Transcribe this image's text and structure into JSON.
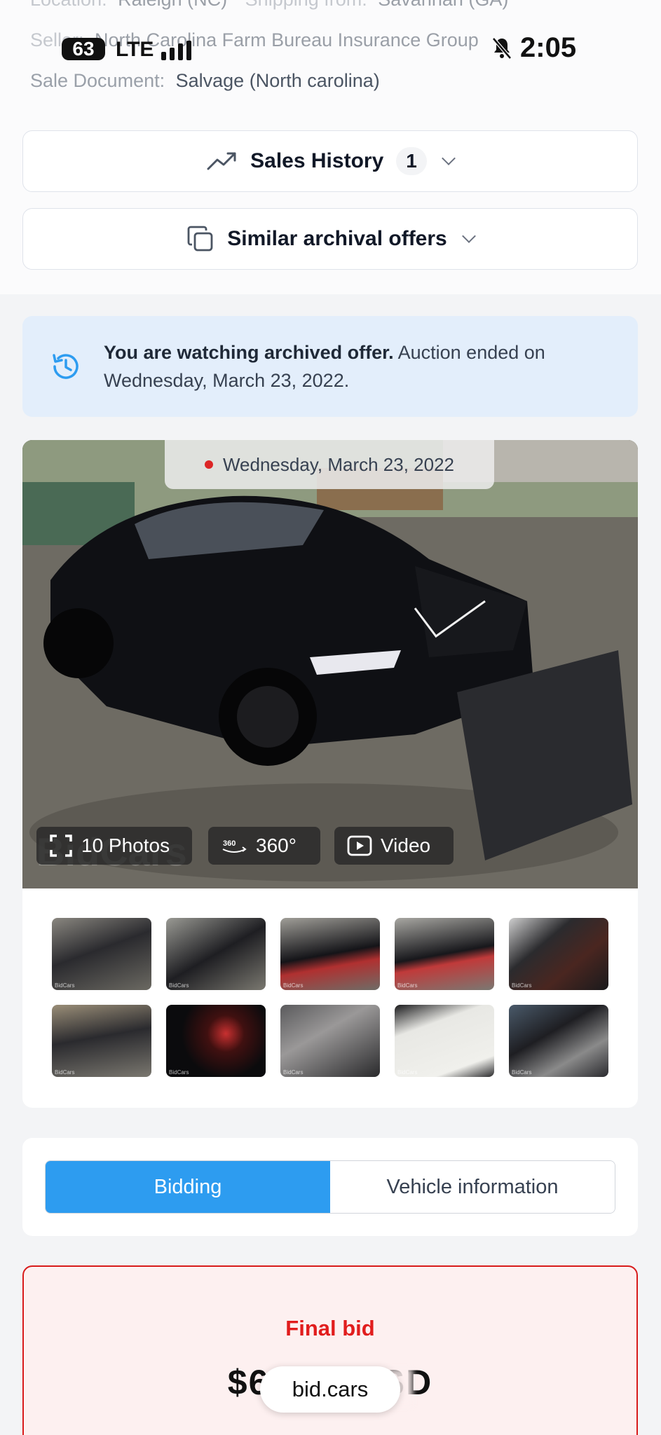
{
  "status_bar": {
    "battery": "63",
    "network": "LTE",
    "time": "2:05"
  },
  "lot_info": {
    "location_label": "Location:",
    "location_value": "Raleigh (NC)",
    "shipping_label": "Shipping from:",
    "shipping_value": "Savannah (GA)",
    "seller_label": "Seller:",
    "seller_value": "North Carolina Farm Bureau Insurance Group",
    "doc_label": "Sale Document:",
    "doc_value": "Salvage (North carolina)"
  },
  "sales_history": {
    "label": "Sales History",
    "count": "1"
  },
  "similar": {
    "label": "Similar archival offers"
  },
  "notice": {
    "bold": "You are watching archived offer.",
    "text": " Auction ended on Wednesday, March 23, 2022."
  },
  "gallery": {
    "date": "Wednesday, March 23, 2022",
    "photos_label": "10 Photos",
    "view360_label": "360°",
    "video_label": "Video",
    "watermark": "BidCars",
    "thumb_watermark": "BidCars"
  },
  "tabs": {
    "bidding": "Bidding",
    "vehicle_info": "Vehicle information"
  },
  "final_bid": {
    "label": "Final bid",
    "amount": "$6,335 USD"
  },
  "url_bar": {
    "text": "bid.cars"
  },
  "colors": {
    "accent": "#2d9cf0",
    "danger": "#e11d1d",
    "notice_bg": "#e3eefb"
  }
}
